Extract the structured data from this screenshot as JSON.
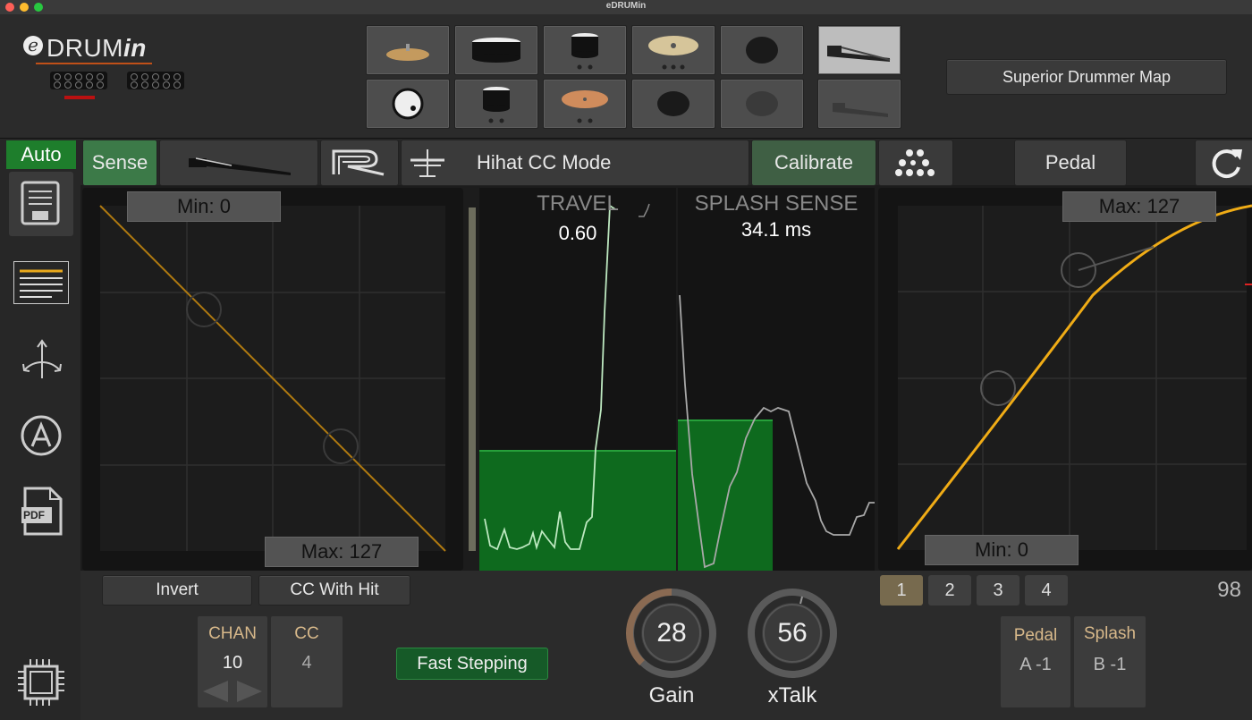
{
  "window": {
    "title": "eDRUMin"
  },
  "header": {
    "logo_e": "e",
    "logo_drum": "DRUM",
    "logo_in": "in",
    "map_button": "Superior Drummer Map"
  },
  "toolbar": {
    "sense": "Sense",
    "mode": "Hihat CC Mode",
    "calibrate": "Calibrate",
    "pedal": "Pedal"
  },
  "sidebar": {
    "auto": "Auto",
    "pdf": "PDF"
  },
  "left_graph": {
    "min_label": "Min: 0",
    "max_label": "Max: 127"
  },
  "travel": {
    "label": "TRAVEL",
    "value": "0.60"
  },
  "splash": {
    "label": "SPLASH SENSE",
    "value": "34.1 ms"
  },
  "right_graph": {
    "max_label": "Max: 127",
    "min_label": "Min: 0"
  },
  "bottom": {
    "invert": "Invert",
    "cc_with_hit": "CC With Hit",
    "chan_label": "CHAN",
    "chan_value": "10",
    "cc_label": "CC",
    "cc_value": "4",
    "fast_stepping": "Fast Stepping",
    "gain_value": "28",
    "gain_label": "Gain",
    "xtalk_value": "56",
    "xtalk_label": "xTalk",
    "tabs": [
      "1",
      "2",
      "3",
      "4"
    ],
    "counter": "98",
    "pedal_label": "Pedal",
    "pedal_value": "A -1",
    "splash_label": "Splash",
    "splash_value": "B -1"
  },
  "colors": {
    "accent_orange": "#e8a81c",
    "green": "#1e7e2c",
    "meter_green": "#0e6a1e"
  }
}
